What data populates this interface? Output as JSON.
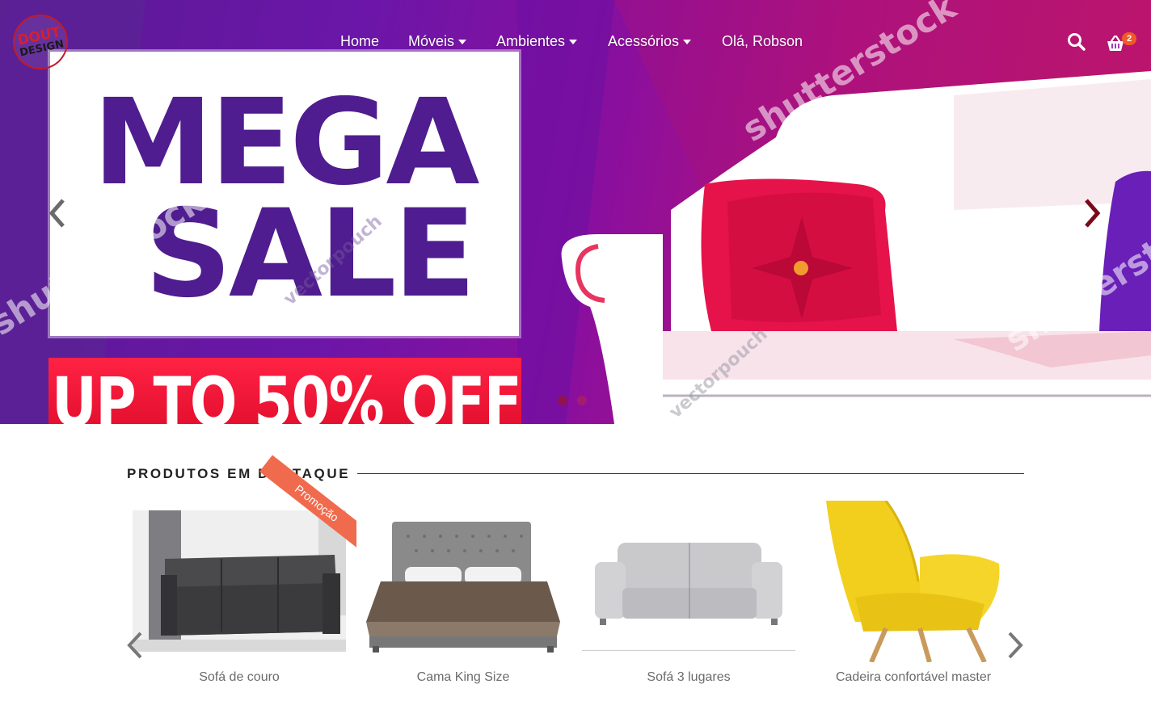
{
  "brand": {
    "logo_top": "DOUT",
    "logo_bottom": "DESIGN"
  },
  "nav": {
    "home": "Home",
    "moveis": "Móveis",
    "ambientes": "Ambientes",
    "acessorios": "Acessórios",
    "greeting": "Olá, Robson"
  },
  "cart": {
    "count": "2"
  },
  "hero": {
    "line1": "MEGA",
    "line2": "SALE",
    "offer": "UP TO 50% OFF",
    "watermark_main": "shutterstock",
    "watermark_author": "vectorpouch"
  },
  "featured": {
    "title": "PRODUTOS EM DESTAQUE",
    "promo_label": "Promoção",
    "products": [
      {
        "name": "Sofá de couro"
      },
      {
        "name": "Cama King Size"
      },
      {
        "name": "Sofá 3 lugares"
      },
      {
        "name": "Cadeira confortável master"
      }
    ]
  },
  "colors": {
    "promo": "#f06a4d",
    "badge": "#f05a28",
    "brand_red": "#c21b2a"
  }
}
